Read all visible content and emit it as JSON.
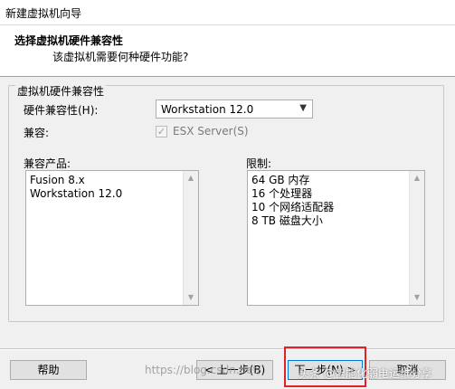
{
  "window": {
    "title": "新建虚拟机向导"
  },
  "header": {
    "title": "选择虚拟机硬件兼容性",
    "subtitle": "该虚拟机需要何种硬件功能?"
  },
  "group": {
    "legend": "虚拟机硬件兼容性"
  },
  "compat": {
    "label": "硬件兼容性(H):",
    "selected": "Workstation 12.0",
    "compat_label": "兼容:",
    "esx_label": "ESX Server(S)",
    "esx_checked": true,
    "esx_disabled": true
  },
  "products": {
    "label": "兼容产品:",
    "items": [
      "Fusion 8.x",
      "Workstation 12.0"
    ]
  },
  "limits": {
    "label": "限制:",
    "items": [
      "64 GB 内存",
      "16 个处理器",
      "10 个网络适配器",
      "8 TB 磁盘大小"
    ]
  },
  "buttons": {
    "help": "帮助",
    "back": "< 上一步(B)",
    "next": "下一步(N) >",
    "cancel": "取消"
  },
  "overlay": {
    "watermark_left": "https://blog.csdn.net/",
    "watermark_right": "头条 @智能化弱电运维分享"
  },
  "colors": {
    "highlight": "#e0212b",
    "accent": "#0078d7"
  }
}
